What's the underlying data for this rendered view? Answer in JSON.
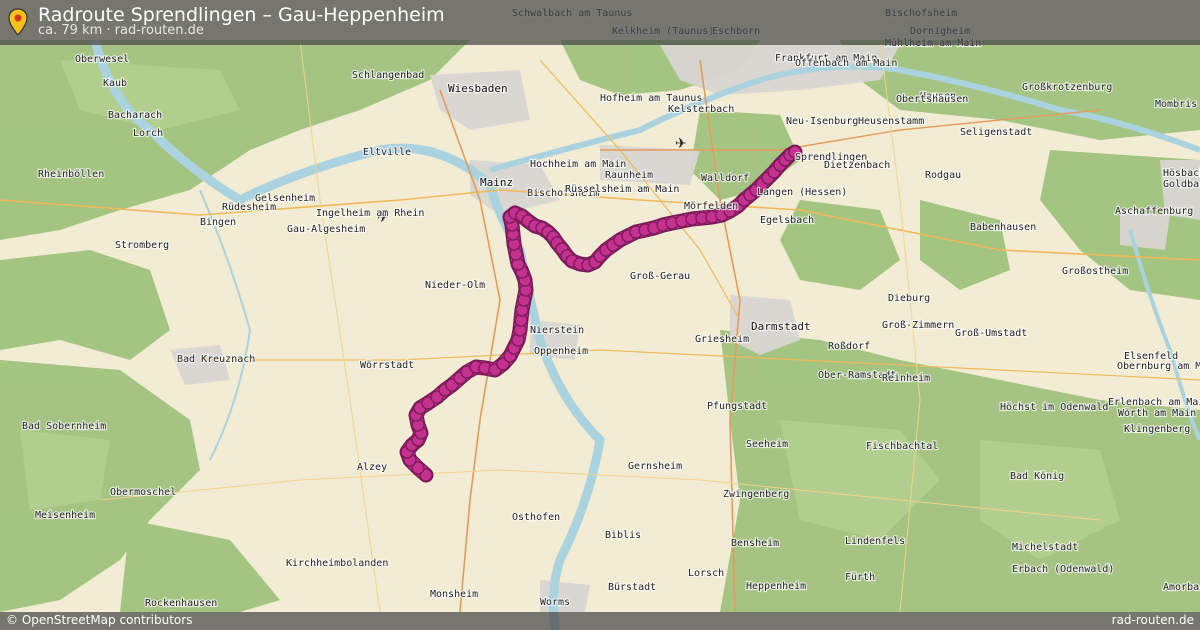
{
  "header": {
    "title": "Radroute Sprendlingen – Gau-Heppenheim",
    "subtitle": "ca. 79 km · rad-routen.de",
    "pin_icon": "map-pin-icon"
  },
  "footer": {
    "attribution": "© OpenStreetMap contributors",
    "brand": "rad-routen.de"
  },
  "colors": {
    "route": "#c4318f",
    "route_outline": "#7a1a58",
    "forest": "#9cc07a",
    "farmland": "#f1ecd3",
    "urban": "#d8d6d2",
    "water": "#aad3df",
    "header_bg": "#464646"
  },
  "places": [
    "Schwalbach am Taunus",
    "Bischofsheim",
    "Kelkheim (Taunus)",
    "Eschborn",
    "Dornigheim",
    "Frankfurt am Main",
    "Mühlheim am Main",
    "Offenbach am Main",
    "Hausen",
    "Obertshausen",
    "Großkrotzenburg",
    "Mombris",
    "Oberwesel",
    "Kaub",
    "Schlangenbad",
    "Wiesbaden",
    "Hofheim am Taunus",
    "Kelsterbach",
    "Neu-Isenburg",
    "Heusenstamm",
    "Seligenstadt",
    "Bacharach",
    "Lorch",
    "Eltville",
    "Hochheim am Main",
    "Raunheim",
    "Sprendlingen",
    "Dietzenbach",
    "Rheinböllen",
    "Mainz",
    "Bischofsheim",
    "Rüsselsheim am Main",
    "Walldorf",
    "Langen (Hessen)",
    "Rodgau",
    "Hösbach",
    "Goldbach",
    "Gelsenheim",
    "Rüdesheim",
    "Ingelheim am Rhein",
    "Mörfelden",
    "Egelsbach",
    "Bingen",
    "Gau-Algesheim",
    "Aschaffenburg",
    "Babenhausen",
    "Stromberg",
    "Groß-Gerau",
    "Nieder-Olm",
    "Großostheim",
    "Dieburg",
    "Nierstein",
    "Darmstadt",
    "Groß-Zimmern",
    "Groß-Umstadt",
    "Oppenheim",
    "Griesheim",
    "Roßdorf",
    "Bad Kreuznach",
    "Wörrstadt",
    "Elsenfeld",
    "Obernburg am Main",
    "Ober-Ramstadt",
    "Reinheim",
    "Pfungstadt",
    "Höchst im Odenwald",
    "Erlenbach am Main",
    "Wörth am Main",
    "Bad Sobernheim",
    "Klingenberg",
    "Seeheim",
    "Fischbachtal",
    "Alzey",
    "Gernsheim",
    "Bad König",
    "Obermoschel",
    "Zwingenberg",
    "Osthofen",
    "Meisenheim",
    "Biblis",
    "Bensheim",
    "Lindenfels",
    "Michelstadt",
    "Kirchheimbolanden",
    "Lorsch",
    "Erbach (Odenwald)",
    "Bürstadt",
    "Heppenheim",
    "Fürth",
    "Amorbach",
    "Monsheim",
    "Worms",
    "Rockenhausen"
  ]
}
